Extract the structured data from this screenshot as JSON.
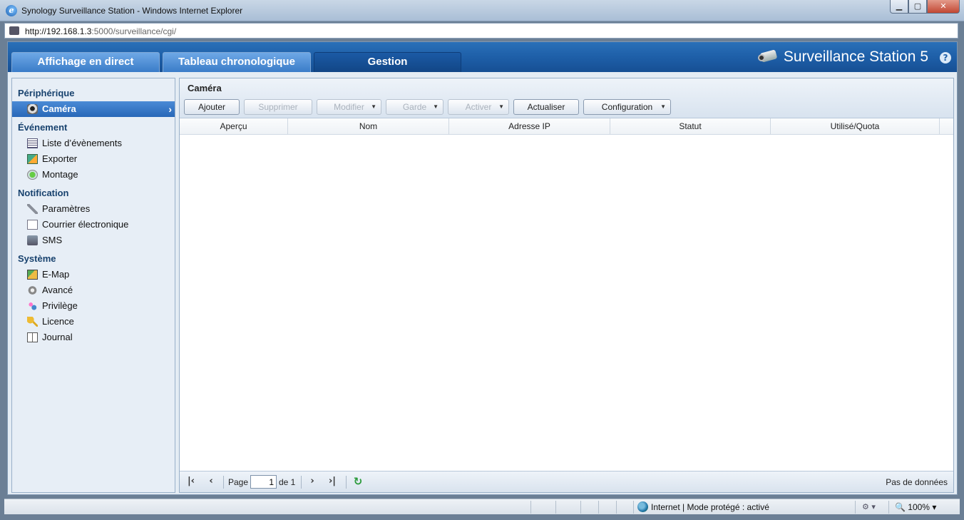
{
  "window": {
    "title": "Synology Surveillance Station - Windows Internet Explorer",
    "url_host": "http://192.168.1.3",
    "url_rest": ":5000/surveillance/cgi/"
  },
  "app": {
    "brand": "Surveillance Station 5",
    "help": "?",
    "tabs": [
      {
        "label": "Affichage en direct"
      },
      {
        "label": "Tableau chronologique"
      },
      {
        "label": "Gestion",
        "active": true
      }
    ]
  },
  "sidebar": {
    "sections": [
      {
        "title": "Périphérique",
        "items": [
          {
            "label": "Caméra",
            "icon": "camera-icon",
            "active": true
          }
        ]
      },
      {
        "title": "Événement",
        "items": [
          {
            "label": "Liste d’évènements",
            "icon": "event-list-icon"
          },
          {
            "label": "Exporter",
            "icon": "export-icon"
          },
          {
            "label": "Montage",
            "icon": "mount-icon"
          }
        ]
      },
      {
        "title": "Notification",
        "items": [
          {
            "label": "Paramètres",
            "icon": "wrench-icon"
          },
          {
            "label": "Courrier électronique",
            "icon": "mail-icon"
          },
          {
            "label": "SMS",
            "icon": "sms-icon"
          }
        ]
      },
      {
        "title": "Système",
        "items": [
          {
            "label": "E-Map",
            "icon": "emap-icon"
          },
          {
            "label": "Avancé",
            "icon": "gear-icon"
          },
          {
            "label": "Privilège",
            "icon": "users-icon"
          },
          {
            "label": "Licence",
            "icon": "key-icon"
          },
          {
            "label": "Journal",
            "icon": "book-icon"
          }
        ]
      }
    ]
  },
  "main": {
    "title": "Caméra",
    "toolbar": {
      "add": "Ajouter",
      "delete": "Supprimer",
      "edit": "Modifier",
      "guard": "Garde",
      "enable": "Activer",
      "refresh": "Actualiser",
      "config": "Configuration"
    },
    "columns": [
      "Aperçu",
      "Nom",
      "Adresse IP",
      "Statut",
      "Utilisé/Quota"
    ],
    "pager": {
      "page_label": "Page",
      "page_value": "1",
      "of_label": "de 1",
      "no_data": "Pas de données"
    }
  },
  "statusbar": {
    "zone": "Internet | Mode protégé : activé",
    "zoom": "100%"
  }
}
